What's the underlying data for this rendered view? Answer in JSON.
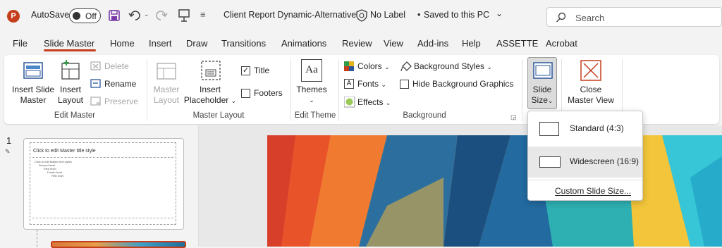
{
  "titlebar": {
    "app_icon": "P",
    "autosave_label": "AutoSave",
    "autosave_state": "Off",
    "doc_title": "Client Report Dynamic-Alternative",
    "sensitivity": "No Label",
    "save_status": "Saved to this PC",
    "search_placeholder": "Search",
    "icons": [
      "save-icon",
      "undo-icon",
      "redo-icon",
      "present-icon",
      "customize-qat-icon",
      "shield-icon",
      "chevron-down-icon",
      "search-icon"
    ]
  },
  "tabs": [
    "File",
    "Slide Master",
    "Home",
    "Insert",
    "Draw",
    "Transitions",
    "Animations",
    "Review",
    "View",
    "Add-ins",
    "Help",
    "ASSETTE",
    "Acrobat"
  ],
  "active_tab": "Slide Master",
  "ribbon": {
    "edit_master": {
      "label": "Edit Master",
      "insert_slide_master": [
        "Insert Slide",
        "Master"
      ],
      "insert_layout": [
        "Insert",
        "Layout"
      ],
      "delete": "Delete",
      "rename": "Rename",
      "preserve": "Preserve"
    },
    "master_layout": {
      "label": "Master Layout",
      "master_layout_btn": [
        "Master",
        "Layout"
      ],
      "insert_placeholder": [
        "Insert",
        "Placeholder"
      ],
      "title_cb": "Title",
      "title_checked": true,
      "footers_cb": "Footers",
      "footers_checked": false
    },
    "edit_theme": {
      "label": "Edit Theme",
      "themes": "Themes",
      "themes_icon_text": "Aa"
    },
    "background": {
      "label": "Background",
      "colors": "Colors",
      "fonts": "Fonts",
      "effects": "Effects",
      "background_styles": "Background Styles",
      "hide_bg_graphics": "Hide Background Graphics",
      "hide_checked": false
    },
    "size": {
      "slide_size": [
        "Slide",
        "Size"
      ]
    },
    "close": {
      "close_master_view": [
        "Close",
        "Master View"
      ]
    }
  },
  "thumbnail": {
    "number": "1",
    "title_text": "Click to edit Master title style",
    "body_lines": [
      "Click to edit Master text styles",
      "Second level",
      "Third level",
      "Fourth level",
      "Fifth level"
    ]
  },
  "dropdown": {
    "items": [
      "Standard (4:3)",
      "Widescreen (16:9)"
    ],
    "hovered": "Widescreen (16:9)",
    "custom": "Custom Slide Size..."
  },
  "colors": {
    "accent": "#c43e1c",
    "ribbon_bg": "#ffffff",
    "chrome_bg": "#f3f3f3"
  }
}
